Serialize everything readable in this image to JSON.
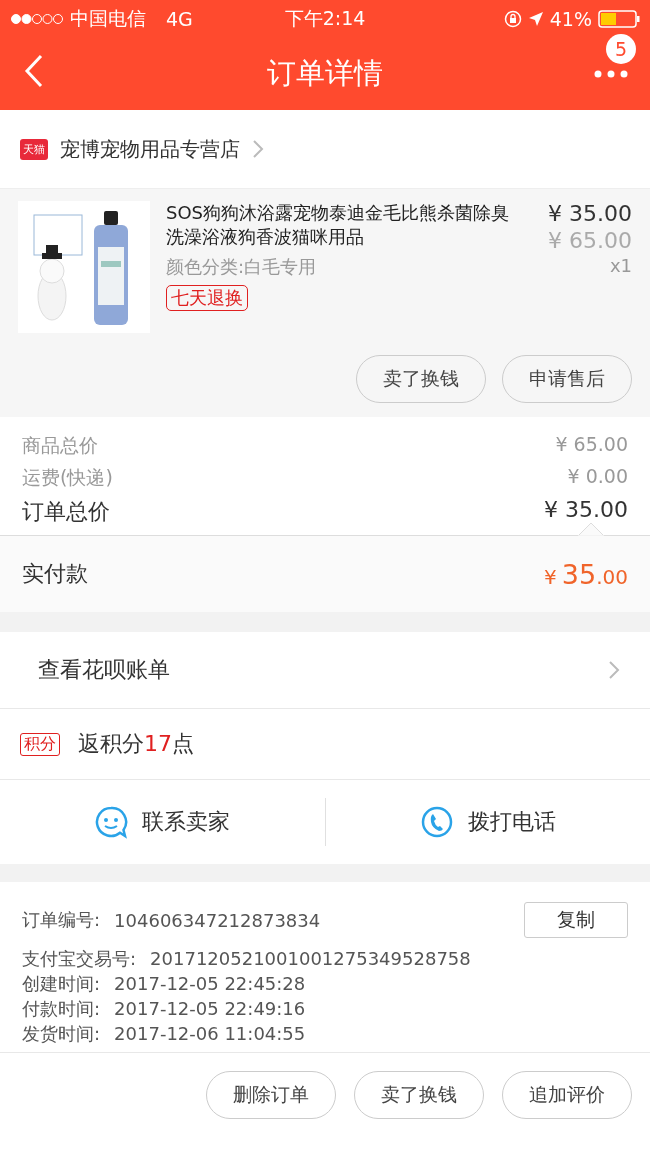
{
  "status_bar": {
    "carrier": "中国电信",
    "network": "4G",
    "time": "下午2:14",
    "battery": "41%"
  },
  "nav": {
    "title": "订单详情",
    "badge": "5"
  },
  "store": {
    "badge": "天猫",
    "name": "宠博宠物用品专营店"
  },
  "product": {
    "kind": "picture",
    "title": "SOS狗狗沐浴露宠物泰迪金毛比熊杀菌除臭洗澡浴液狗香波猫咪用品",
    "sku": "颜色分类:白毛专用",
    "tag": "七天退换",
    "price": "¥ 35.00",
    "original_price": "¥ 65.00",
    "quantity": "x1",
    "actions": [
      "卖了换钱",
      "申请售后"
    ]
  },
  "summary": [
    {
      "label": "商品总价",
      "value": "¥ 65.00",
      "kind": "minor"
    },
    {
      "label": "运费(快递)",
      "value": "¥ 0.00",
      "kind": "minor"
    },
    {
      "label": "订单总价",
      "value": "¥ 35.00",
      "kind": "major"
    }
  ],
  "paid": {
    "label": "实付款",
    "currency": "¥",
    "integer": "35",
    "decimal": ".00"
  },
  "huabei": {
    "label": "查看花呗账单"
  },
  "points": {
    "badge": "积分",
    "before": "返积分",
    "count": "17",
    "after": "点"
  },
  "contact": [
    {
      "label": "联系卖家",
      "kind": "chat"
    },
    {
      "label": "拨打电话",
      "kind": "phone"
    }
  ],
  "order_info": {
    "copy_button": "复制",
    "rows": [
      {
        "label": "订单编号:",
        "value": "104606347212873834"
      },
      {
        "label": "支付宝交易号:",
        "value": "2017120521001001275349528758"
      },
      {
        "label": "创建时间:",
        "value": "2017-12-05 22:45:28"
      },
      {
        "label": "付款时间:",
        "value": "2017-12-05 22:49:16"
      },
      {
        "label": "发货时间:",
        "value": "2017-12-06 11:04:55"
      }
    ]
  },
  "bottom_actions": [
    "删除订单",
    "卖了换钱",
    "追加评价"
  ]
}
